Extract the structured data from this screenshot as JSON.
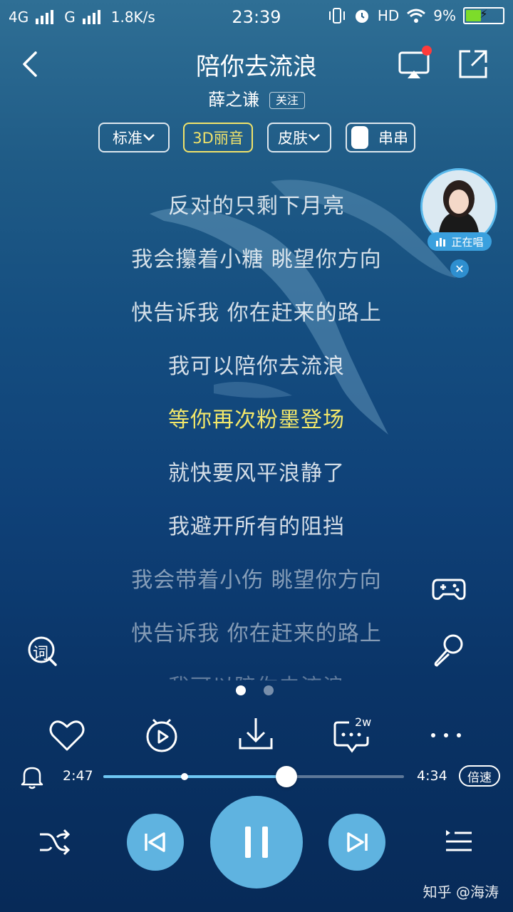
{
  "status_bar": {
    "network_1": "4G",
    "network_2": "G",
    "speed": "1.8K/s",
    "time": "23:39",
    "hd": "HD",
    "battery_percent": "9%",
    "battery_level": 0.09
  },
  "header": {
    "song_title": "陪你去流浪",
    "artist": "薛之谦",
    "follow_label": "关注"
  },
  "chips": {
    "quality_label": "标准",
    "effect_label": "3D丽音",
    "skin_label": "皮肤",
    "toggle_label": "串串"
  },
  "lyrics": [
    {
      "text": "反对的只剩下月亮",
      "state": "normal"
    },
    {
      "text": "我会攥着小糖 眺望你方向",
      "state": "normal"
    },
    {
      "text": "快告诉我 你在赶来的路上",
      "state": "normal"
    },
    {
      "text": "我可以陪你去流浪",
      "state": "normal"
    },
    {
      "text": "等你再次粉墨登场",
      "state": "active"
    },
    {
      "text": "就快要风平浪静了",
      "state": "normal"
    },
    {
      "text": "我避开所有的阻挡",
      "state": "normal"
    },
    {
      "text": "我会带着小伤 眺望你方向",
      "state": "faded"
    },
    {
      "text": "快告诉我 你在赶来的路上",
      "state": "faded"
    },
    {
      "text": "我可以陪你去流浪",
      "state": "cut"
    }
  ],
  "singer_widget": {
    "badge_label": "正在唱"
  },
  "side_buttons": {
    "lyrics_icon_text": "词"
  },
  "pager": {
    "count": 2,
    "active_index": 0
  },
  "actions": {
    "comment_count": "2w"
  },
  "progress": {
    "current_time": "2:47",
    "total_time": "4:34",
    "played_fraction": 0.61,
    "buffered_fraction": 0.27,
    "speed_label": "倍速"
  },
  "watermark": "知乎 @海涛",
  "colors": {
    "accent": "#5fb3e0",
    "active_lyric": "#f2e76a",
    "progress": "#6fc7f3"
  }
}
